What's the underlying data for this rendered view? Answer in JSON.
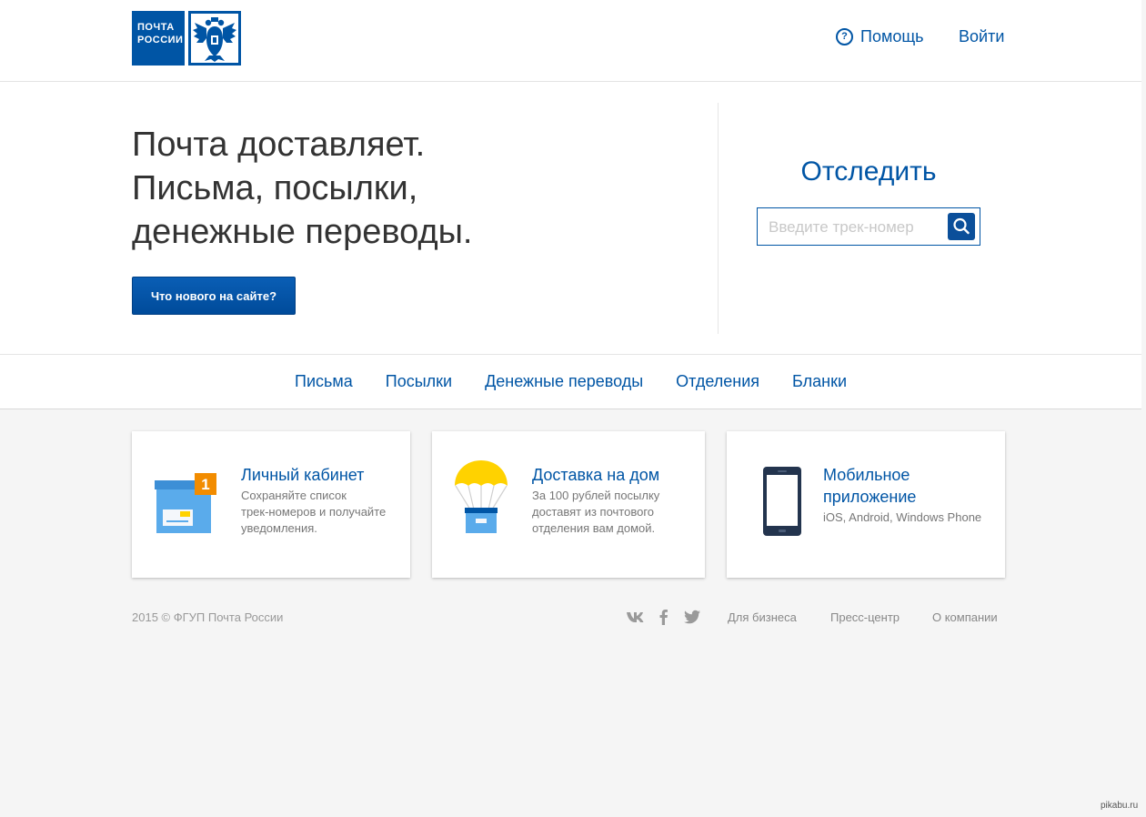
{
  "header": {
    "logo_line1": "ПОЧТА",
    "logo_line2": "РОССИИ",
    "help_label": "Помощь",
    "login_label": "Войти"
  },
  "hero": {
    "headline_line1": "Почта доставляет.",
    "headline_line2": "Письма, посылки,",
    "headline_line3": "денежные переводы.",
    "whats_new_button": "Что нового на сайте?"
  },
  "tracking": {
    "title": "Отследить",
    "placeholder": "Введите трек-номер"
  },
  "nav": {
    "items": [
      "Письма",
      "Посылки",
      "Денежные переводы",
      "Отделения",
      "Бланки"
    ]
  },
  "cards": [
    {
      "icon": "box-icon",
      "badge": "1",
      "title": "Личный кабинет",
      "desc_lines": [
        "Сохраняйте список",
        "трек-номеров и получайте",
        "уведомления."
      ]
    },
    {
      "icon": "parachute-box-icon",
      "title": "Доставка на дом",
      "desc_lines": [
        "За 100 рублей посылку",
        "доставят из почтового",
        "отделения вам домой."
      ]
    },
    {
      "icon": "smartphone-icon",
      "title_lines": [
        "Мобильное",
        "приложение"
      ],
      "desc_lines": [
        "iOS, Android, Windows Phone"
      ]
    }
  ],
  "footer": {
    "copyright": "2015 © ФГУП Почта России",
    "social": [
      "vk-icon",
      "facebook-icon",
      "twitter-icon"
    ],
    "links": [
      "Для бизнеса",
      "Пресс-центр",
      "О компании"
    ]
  },
  "watermark": "pikabu.ru",
  "colors": {
    "brand_blue": "#0055a5",
    "button_blue": "#0b4f9a",
    "badge_orange": "#f28c00",
    "box_blue": "#5aabeb",
    "parachute_yellow": "#ffd200",
    "page_background": "#f5f5f5"
  }
}
